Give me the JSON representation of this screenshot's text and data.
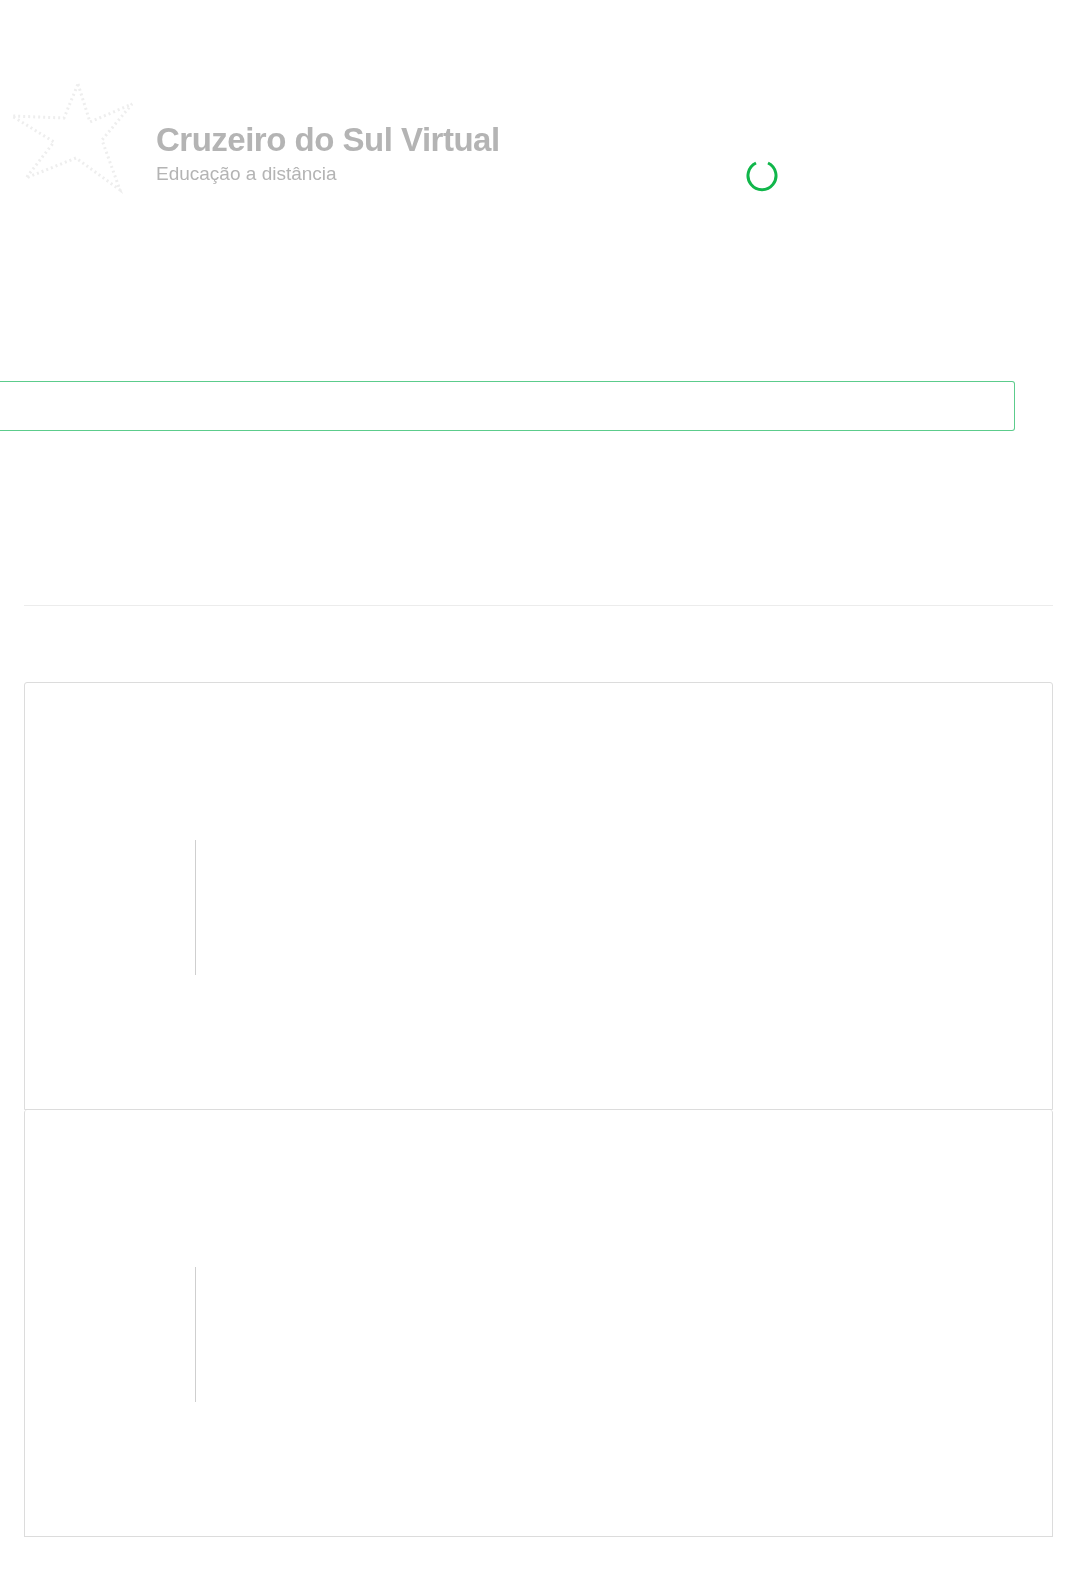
{
  "brand": {
    "name": "Cruzeiro do Sul Virtual",
    "tagline": "Educação a distância"
  },
  "loading": true,
  "cards": [
    {
      "kind": "placeholder"
    },
    {
      "kind": "placeholder"
    }
  ]
}
